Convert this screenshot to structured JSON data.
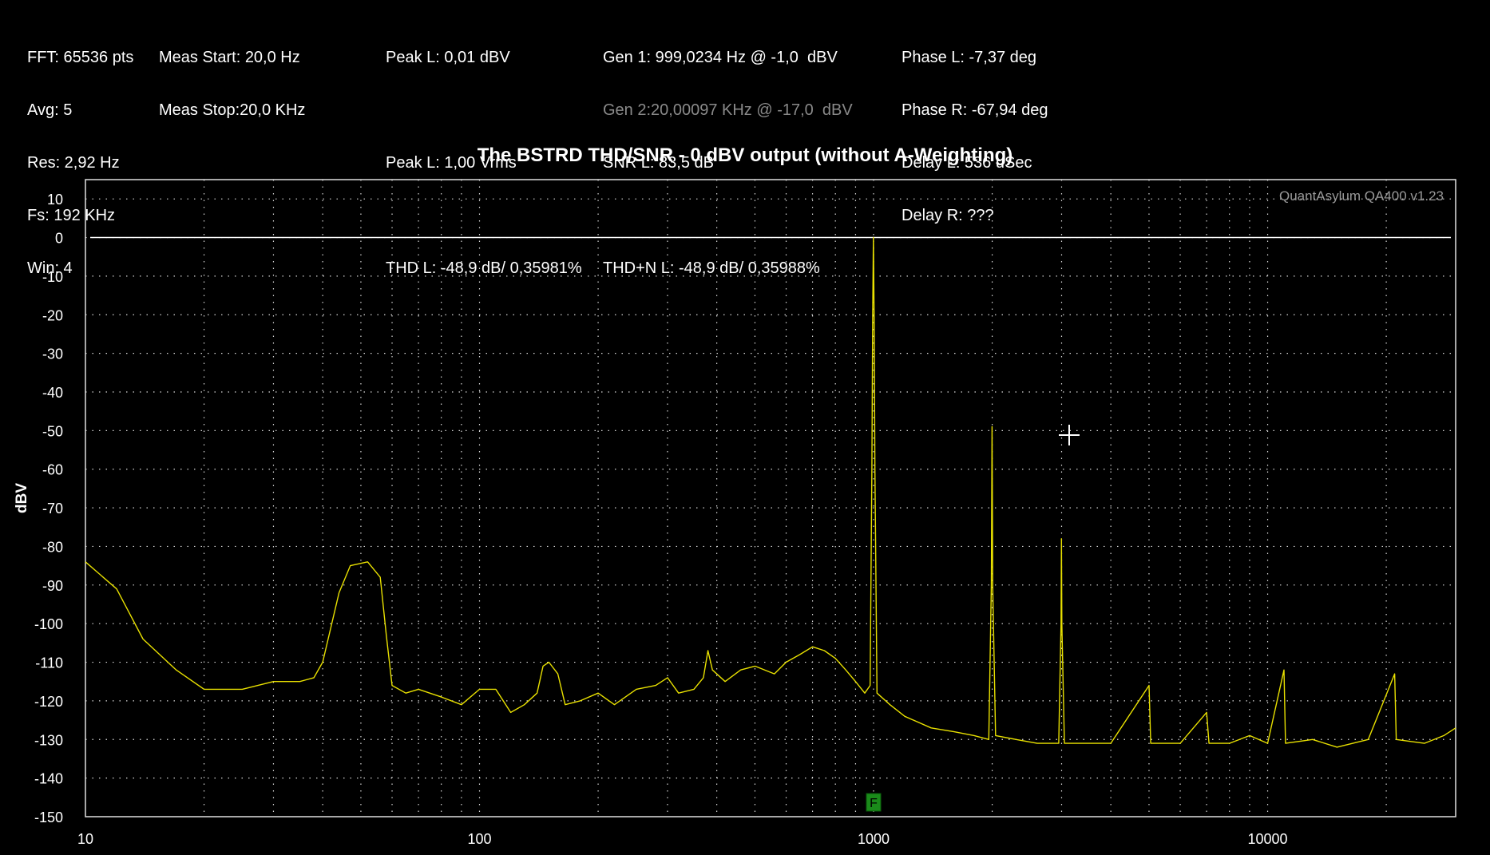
{
  "header": {
    "col1": [
      "FFT: 65536 pts",
      "Avg: 5",
      "Res: 2,92 Hz",
      "Fs: 192 KHz",
      "Win: 4"
    ],
    "col2": [
      "Meas Start: 20,0 Hz",
      "Meas Stop:20,0 KHz"
    ],
    "col3": {
      "peak_dbv": "Peak L: 0,01 dBV",
      "peak_vrms": "Peak L: 1,00 Vrms",
      "thd": "THD L: -48,9 dB/ 0,35981%"
    },
    "col4": {
      "gen1": "Gen 1: 999,0234 Hz @ -1,0  dBV",
      "gen2": "Gen 2:20,00097 KHz @ -17,0  dBV",
      "snr": "SNR L: 83,5 dB",
      "thdn": "THD+N L: -48,9 dB/ 0,35988%"
    },
    "col5": [
      "Phase L: -7,37 deg",
      "Phase R: -67,94 deg",
      "Delay L: 536 uSec",
      "Delay R: ???"
    ]
  },
  "chart_data": {
    "type": "line",
    "title": "The BSTRD THD/SNR - 0 dBV output (without A-Weighting)",
    "xlabel": "",
    "ylabel": "dBV",
    "x_scale": "log",
    "xlim": [
      10,
      30000
    ],
    "ylim": [
      -150,
      15
    ],
    "x_ticks": [
      "10",
      "100",
      "1000",
      "10000"
    ],
    "y_ticks": [
      "10",
      "0",
      "-10",
      "-20",
      "-30",
      "-40",
      "-50",
      "-60",
      "-70",
      "-80",
      "-90",
      "-100",
      "-110",
      "-120",
      "-130",
      "-140",
      "-150"
    ],
    "reference_line": 0,
    "grid": true,
    "watermark": "QuantAsylum QA400 v1.23",
    "marker_label": "F",
    "marker_freq": 1000,
    "colors": {
      "trace": "#e8e000",
      "grid": "#d8d8d8",
      "background": "#000000"
    },
    "series": [
      {
        "values": [
          [
            10,
            -84
          ],
          [
            12,
            -91
          ],
          [
            14,
            -104
          ],
          [
            17,
            -112
          ],
          [
            20,
            -117
          ],
          [
            25,
            -117
          ],
          [
            30,
            -115
          ],
          [
            35,
            -115
          ],
          [
            38,
            -114
          ],
          [
            40,
            -110
          ],
          [
            44,
            -92
          ],
          [
            47,
            -85
          ],
          [
            52,
            -84
          ],
          [
            56,
            -88
          ],
          [
            58,
            -103
          ],
          [
            60,
            -116
          ],
          [
            65,
            -118
          ],
          [
            70,
            -117
          ],
          [
            80,
            -119
          ],
          [
            90,
            -121
          ],
          [
            100,
            -117
          ],
          [
            110,
            -117
          ],
          [
            120,
            -123
          ],
          [
            130,
            -121
          ],
          [
            140,
            -118
          ],
          [
            145,
            -111
          ],
          [
            150,
            -110
          ],
          [
            158,
            -113
          ],
          [
            165,
            -121
          ],
          [
            180,
            -120
          ],
          [
            200,
            -118
          ],
          [
            220,
            -121
          ],
          [
            250,
            -117
          ],
          [
            280,
            -116
          ],
          [
            300,
            -114
          ],
          [
            320,
            -118
          ],
          [
            350,
            -117
          ],
          [
            370,
            -114
          ],
          [
            380,
            -107
          ],
          [
            390,
            -112
          ],
          [
            420,
            -115
          ],
          [
            460,
            -112
          ],
          [
            500,
            -111
          ],
          [
            560,
            -113
          ],
          [
            600,
            -110
          ],
          [
            650,
            -108
          ],
          [
            700,
            -106
          ],
          [
            750,
            -107
          ],
          [
            800,
            -109
          ],
          [
            850,
            -112
          ],
          [
            900,
            -115
          ],
          [
            950,
            -118
          ],
          [
            980,
            -116
          ],
          [
            990,
            -60
          ],
          [
            995,
            -20
          ],
          [
            999,
            0
          ],
          [
            1003,
            -20
          ],
          [
            1008,
            -60
          ],
          [
            1020,
            -118
          ],
          [
            1100,
            -121
          ],
          [
            1200,
            -124
          ],
          [
            1400,
            -127
          ],
          [
            1600,
            -128
          ],
          [
            1800,
            -129
          ],
          [
            1960,
            -130
          ],
          [
            1990,
            -90
          ],
          [
            1998,
            -49
          ],
          [
            2006,
            -90
          ],
          [
            2040,
            -129
          ],
          [
            2300,
            -130
          ],
          [
            2600,
            -131
          ],
          [
            2950,
            -131
          ],
          [
            2990,
            -100
          ],
          [
            2997,
            -78
          ],
          [
            3004,
            -100
          ],
          [
            3050,
            -131
          ],
          [
            3500,
            -131
          ],
          [
            4000,
            -131
          ],
          [
            5000,
            -116
          ],
          [
            5050,
            -131
          ],
          [
            6000,
            -131
          ],
          [
            7000,
            -123
          ],
          [
            7100,
            -131
          ],
          [
            8000,
            -131
          ],
          [
            9000,
            -129
          ],
          [
            10000,
            -131
          ],
          [
            11000,
            -112
          ],
          [
            11100,
            -131
          ],
          [
            13000,
            -130
          ],
          [
            15000,
            -132
          ],
          [
            18000,
            -130
          ],
          [
            21000,
            -113
          ],
          [
            21200,
            -130
          ],
          [
            25000,
            -131
          ],
          [
            28000,
            -129
          ],
          [
            30000,
            -127
          ]
        ]
      }
    ]
  }
}
